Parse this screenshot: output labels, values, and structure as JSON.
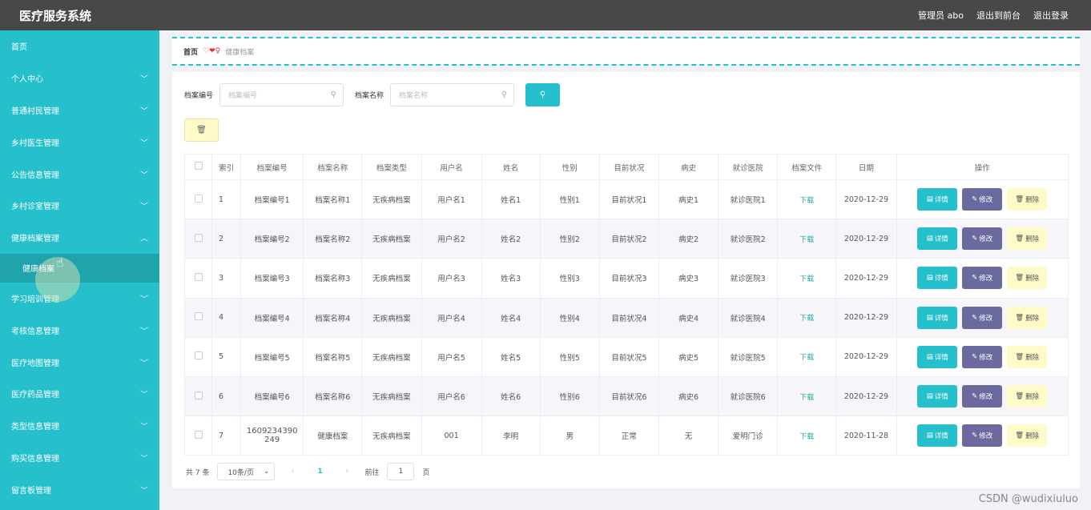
{
  "header": {
    "title": "医疗服务系统",
    "user": "管理员 abo",
    "back_to_front": "退出到前台",
    "logout": "退出登录"
  },
  "sidebar": {
    "items": [
      {
        "label": "首页",
        "chevron": false
      },
      {
        "label": "个人中心",
        "chevron": "down"
      },
      {
        "label": "普通村民管理",
        "chevron": "down"
      },
      {
        "label": "乡村医生管理",
        "chevron": "down"
      },
      {
        "label": "公告信息管理",
        "chevron": "down"
      },
      {
        "label": "乡村诊室管理",
        "chevron": "down"
      },
      {
        "label": "健康档案管理",
        "chevron": "up"
      },
      {
        "label": "健康档案",
        "sub": true
      },
      {
        "label": "学习培训管理",
        "chevron": "down"
      },
      {
        "label": "考核信息管理",
        "chevron": "down"
      },
      {
        "label": "医疗地图管理",
        "chevron": "down"
      },
      {
        "label": "医疗药品管理",
        "chevron": "down"
      },
      {
        "label": "类型信息管理",
        "chevron": "down"
      },
      {
        "label": "购买信息管理",
        "chevron": "down"
      },
      {
        "label": "留言板管理",
        "chevron": "down"
      }
    ]
  },
  "breadcrumb": {
    "home": "首页",
    "separator": "♡❤♀",
    "current": "健康档案"
  },
  "search": {
    "code_label": "档案编号",
    "code_placeholder": "档案编号",
    "name_label": "档案名称",
    "name_placeholder": "档案名称",
    "search_icon": "search-icon",
    "delete_icon": "trash-icon"
  },
  "table": {
    "headers": [
      "",
      "索引",
      "档案编号",
      "档案名称",
      "档案类型",
      "用户名",
      "姓名",
      "性别",
      "目前状况",
      "病史",
      "就诊医院",
      "档案文件",
      "日期",
      "操作"
    ],
    "rows": [
      {
        "index": "1",
        "code": "档案编号1",
        "name": "档案名称1",
        "type": "无疾病档案",
        "username": "用户名1",
        "realname": "姓名1",
        "gender": "性别1",
        "status": "目前状况1",
        "history": "病史1",
        "hospital": "就诊医院1",
        "file": "下载",
        "date": "2020-12-29"
      },
      {
        "index": "2",
        "code": "档案编号2",
        "name": "档案名称2",
        "type": "无疾病档案",
        "username": "用户名2",
        "realname": "姓名2",
        "gender": "性别2",
        "status": "目前状况2",
        "history": "病史2",
        "hospital": "就诊医院2",
        "file": "下载",
        "date": "2020-12-29"
      },
      {
        "index": "3",
        "code": "档案编号3",
        "name": "档案名称3",
        "type": "无疾病档案",
        "username": "用户名3",
        "realname": "姓名3",
        "gender": "性别3",
        "status": "目前状况3",
        "history": "病史3",
        "hospital": "就诊医院3",
        "file": "下载",
        "date": "2020-12-29"
      },
      {
        "index": "4",
        "code": "档案编号4",
        "name": "档案名称4",
        "type": "无疾病档案",
        "username": "用户名4",
        "realname": "姓名4",
        "gender": "性别4",
        "status": "目前状况4",
        "history": "病史4",
        "hospital": "就诊医院4",
        "file": "下载",
        "date": "2020-12-29"
      },
      {
        "index": "5",
        "code": "档案编号5",
        "name": "档案名称5",
        "type": "无疾病档案",
        "username": "用户名5",
        "realname": "姓名5",
        "gender": "性别5",
        "status": "目前状况5",
        "history": "病史5",
        "hospital": "就诊医院5",
        "file": "下载",
        "date": "2020-12-29"
      },
      {
        "index": "6",
        "code": "档案编号6",
        "name": "档案名称6",
        "type": "无疾病档案",
        "username": "用户名6",
        "realname": "姓名6",
        "gender": "性别6",
        "status": "目前状况6",
        "history": "病史6",
        "hospital": "就诊医院6",
        "file": "下载",
        "date": "2020-12-29"
      },
      {
        "index": "7",
        "code": "1609234390249",
        "name": "健康档案",
        "type": "无疾病档案",
        "username": "001",
        "realname": "李明",
        "gender": "男",
        "status": "正常",
        "history": "无",
        "hospital": "爱明门诊",
        "file": "下载",
        "date": "2020-11-28"
      }
    ],
    "actions": {
      "detail": "详情",
      "edit": "修改",
      "delete": "删除"
    }
  },
  "pagination": {
    "total": "共 7 条",
    "page_size": "10条/页",
    "current_page": "1",
    "goto_label": "前往",
    "goto_value": "1",
    "page_suffix": "页"
  },
  "watermark": "CSDN @wudixiuluo",
  "colors": {
    "accent": "#26c0cd",
    "edit": "#6a6a9e",
    "delete": "#fffbc8",
    "topbar": "#484848"
  }
}
